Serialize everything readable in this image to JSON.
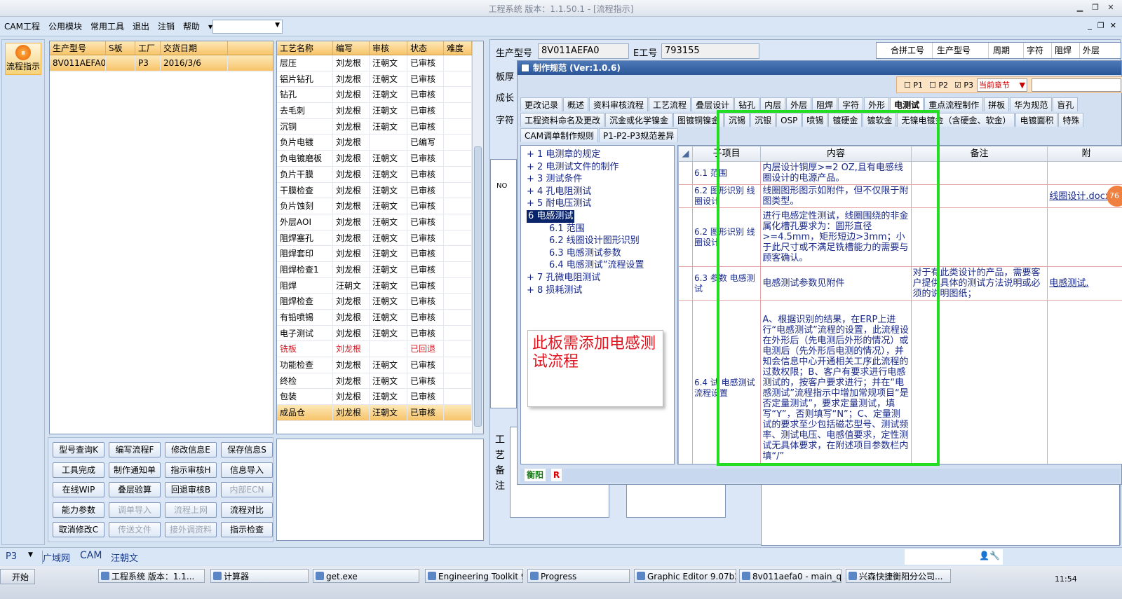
{
  "window": {
    "title": "工程系统  版本：1.1.50.1 - [流程指示]"
  },
  "menu": {
    "items": [
      "CAM工程",
      "公用模块",
      "常用工具",
      "退出",
      "注销",
      "帮助"
    ]
  },
  "left_tool": {
    "label": "流程指示"
  },
  "order_grid": {
    "headers": [
      "生产型号",
      "S板",
      "工厂",
      "交货日期"
    ],
    "rows": [
      [
        "8V011AEFA0",
        "",
        "P3",
        "2016/3/6"
      ]
    ]
  },
  "process_grid": {
    "headers": [
      "工艺名称",
      "编写",
      "审核",
      "状态",
      "难度"
    ],
    "rows": [
      [
        "层压",
        "刘龙根",
        "汪朝文",
        "已审核",
        ""
      ],
      [
        "铝片钻孔",
        "刘龙根",
        "汪朝文",
        "已审核",
        ""
      ],
      [
        "钻孔",
        "刘龙根",
        "汪朝文",
        "已审核",
        ""
      ],
      [
        "去毛刺",
        "刘龙根",
        "汪朝文",
        "已审核",
        ""
      ],
      [
        "沉铜",
        "刘龙根",
        "汪朝文",
        "已审核",
        ""
      ],
      [
        "负片电镀",
        "刘龙根",
        "",
        "已编写",
        ""
      ],
      [
        "负电镀磨板",
        "刘龙根",
        "汪朝文",
        "已审核",
        ""
      ],
      [
        "负片干膜",
        "刘龙根",
        "汪朝文",
        "已审核",
        ""
      ],
      [
        "干膜检查",
        "刘龙根",
        "汪朝文",
        "已审核",
        ""
      ],
      [
        "负片蚀刻",
        "刘龙根",
        "汪朝文",
        "已审核",
        ""
      ],
      [
        "外层AOI",
        "刘龙根",
        "汪朝文",
        "已审核",
        ""
      ],
      [
        "阻焊塞孔",
        "刘龙根",
        "汪朝文",
        "已审核",
        ""
      ],
      [
        "阻焊套印",
        "刘龙根",
        "汪朝文",
        "已审核",
        ""
      ],
      [
        "阻焊检查1",
        "刘龙根",
        "汪朝文",
        "已审核",
        ""
      ],
      [
        "阻焊",
        "汪朝文",
        "汪朝文",
        "已审核",
        ""
      ],
      [
        "阻焊检查",
        "刘龙根",
        "汪朝文",
        "已审核",
        ""
      ],
      [
        "有铅喷锡",
        "刘龙根",
        "汪朝文",
        "已审核",
        ""
      ],
      [
        "电子测试",
        "刘龙根",
        "汪朝文",
        "已审核",
        ""
      ],
      [
        "铣板",
        "刘龙根",
        "",
        "已回退",
        ""
      ],
      [
        "功能检查",
        "刘龙根",
        "汪朝文",
        "已审核",
        ""
      ],
      [
        "终检",
        "刘龙根",
        "汪朝文",
        "已审核",
        ""
      ],
      [
        "包装",
        "刘龙根",
        "汪朝文",
        "已审核",
        ""
      ],
      [
        "成品仓",
        "刘龙根",
        "汪朝文",
        "已审核",
        ""
      ]
    ]
  },
  "buttons": [
    "型号查询K",
    "编写流程F",
    "修改信息E",
    "保存信息S",
    "工具完成",
    "制作通知单",
    "指示审核H",
    "信息导入",
    "在线WIP",
    "叠层验算",
    "回退审核B",
    "内部ECN",
    "能力参数",
    "调单导入",
    "流程上网",
    "流程对比",
    "取消修改C",
    "传送文件",
    "接外调资料",
    "指示检查"
  ],
  "header_fields": {
    "model_label": "生产型号",
    "model_value": "8V011AEFA0",
    "e_label": "E工号",
    "e_value": "793155",
    "side_labels": [
      "板厚",
      "成长",
      "字符"
    ],
    "right_cols": [
      "合拼工号",
      "生产型号",
      "周期",
      "字符",
      "阻焊",
      "外层"
    ],
    "no_label": "NO",
    "remark_label": "工艺备注"
  },
  "dialog": {
    "title": "制作规范 (Ver:1.0.6)",
    "filters": [
      "P1",
      "P2",
      "P3"
    ],
    "chapter": "当前章节",
    "tabs_row1": [
      "更改记录",
      "概述",
      "资料审核流程",
      "工艺流程",
      "叠层设计",
      "钻孔",
      "内层",
      "外层",
      "阻焊",
      "字符",
      "外形",
      "电测试",
      "重点流程制作",
      "拼板",
      "华为规范",
      "盲孔"
    ],
    "tabs_row2": [
      "工程资料命名及更改",
      "沉金或化学镍金",
      "图镀铜镍金",
      "沉锡",
      "沉银",
      "OSP",
      "喷锡",
      "镀硬金",
      "镀软金",
      "无镍电镀金（含硬金、软金）",
      "电镀面积",
      "特殊"
    ],
    "tabs_row3": [
      "CAM调单制作规则",
      "P1-P2-P3规范差异"
    ],
    "tree": [
      {
        "t": "+ 1  电测章的规定",
        "lvl": 0
      },
      {
        "t": "+ 2  电测试文件的制作",
        "lvl": 0
      },
      {
        "t": "+ 3  测试条件",
        "lvl": 0
      },
      {
        "t": "+ 4  孔电阻测试",
        "lvl": 0
      },
      {
        "t": "+ 5  耐电压测试",
        "lvl": 0
      },
      {
        "t": "6  电感测试",
        "lvl": 0,
        "sel": true
      },
      {
        "t": "6.1  范围",
        "lvl": 1
      },
      {
        "t": "6.2  线圈设计图形识别",
        "lvl": 1
      },
      {
        "t": "6.3  电感测试参数",
        "lvl": 1
      },
      {
        "t": "6.4  电感测试”流程设置",
        "lvl": 1
      },
      {
        "t": "+ 7  孔微电阻测试",
        "lvl": 0
      },
      {
        "t": "+ 8  损耗测试",
        "lvl": 0
      }
    ],
    "spec_headers": [
      "",
      "子项目",
      "内容",
      "备注",
      "附"
    ],
    "spec_rows": [
      [
        "6.1",
        "范围",
        "内层设计铜厚>=2 OZ,且有电感线圈设计的电源产品。",
        "",
        ""
      ],
      [
        "6.2 图形识别",
        "线圈设计",
        "线圈图形图示如附件，但不仅限于附图类型。",
        "",
        "线圈设计.docx"
      ],
      [
        "6.2 图形识别",
        "线圈设计",
        "进行电感定性测试，线圈围绕的非金属化槽孔要求为：圆形直径>=4.5mm，矩形短边>3mm；小于此尺寸或不满足铣槽能力的需要与顾客确认。",
        "",
        ""
      ],
      [
        "6.3 参数",
        "电感测试",
        "电感测试参数见附件",
        "对于有此类设计的产品，需要客户提供具体的测试方法说明或必须的说明图纸；",
        "电感测试."
      ],
      [
        "6.4 试",
        "电感测试流程设置",
        "A、根据识别的结果，在ERP上进行“电感测试”流程的设置，此流程设在外形后（先电测后外形的情况）或电测后（先外形后电测的情况），并知会信息中心开通相关工序此流程的过数权限；B、客户有要求进行电感测试的，按客户要求进行；并在“电感测试”流程指示中增加常规项目“是否定量测试”，要求定量测试，填写“Y”，否则填写“N”；C、定量测试的要求至少包括磁芯型号、测试频率、测试电压、电感值要求，定性测试无具体要求，在附述项目参数栏内填“/”",
        "",
        ""
      ]
    ],
    "note": "此板需添加电感测试流程",
    "footer": {
      "site": "衡阳",
      "mark": "R"
    },
    "badge": "76"
  },
  "status": {
    "plant": "P3",
    "net": "广域网",
    "cam": "CAM",
    "user": "汪朝文"
  },
  "taskbar": {
    "start": "开始",
    "tasks": [
      "工程系统  版本：1.1...",
      "计算器",
      "get.exe",
      "Engineering Toolkit 9.0...",
      "Progress",
      "Graphic Editor 9.07b2 (...",
      "8v011aefa0 - main_qa",
      "兴森快捷衡阳分公司..."
    ],
    "clock": "11:54"
  },
  "colors": {
    "highlight_box": "#22dd22",
    "accent": "#f7c46a"
  }
}
